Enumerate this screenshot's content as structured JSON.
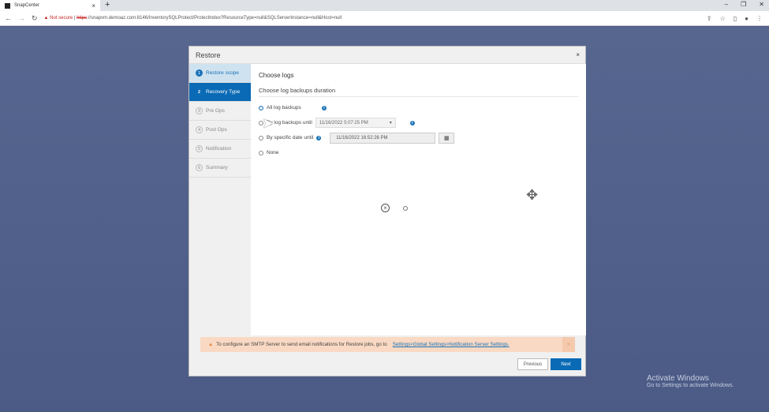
{
  "browser": {
    "tab_title": "SnapCenter",
    "not_secure": "Not secure",
    "url_scheme": "https",
    "url_rest": "://snapvm.demoaz.com:8146/InventorySQLProtect/ProtectIndex?ResourceType=null&SQLServerInstance=null&Host=null"
  },
  "dialog": {
    "title": "Restore",
    "close": "×",
    "steps": [
      {
        "num": "1",
        "label": "Restore scope"
      },
      {
        "num": "2",
        "label": "Recovery Type"
      },
      {
        "num": "3",
        "label": "Pre Ops"
      },
      {
        "num": "4",
        "label": "Post Ops"
      },
      {
        "num": "5",
        "label": "Notification"
      },
      {
        "num": "6",
        "label": "Summary"
      }
    ],
    "heading": "Choose logs",
    "subheading": "Choose log backups duration",
    "options": {
      "all": "All log backups",
      "by_log": "By log backups until",
      "by_date": "By specific date until",
      "none": "None"
    },
    "selected_option": "All log backups",
    "log_backup_select": "11/16/2022 5:07:25 PM",
    "specific_date": "11/16/2022 16:52:26 PM",
    "warning_text": "To configure an SMTP Server to send email notifications for Restore jobs, go to",
    "warning_link": "Settings>Global Settings>Notification Server Settings.",
    "previous": "Previous",
    "next": "Next"
  },
  "watermark": {
    "line1": "Activate Windows",
    "line2": "Go to Settings to activate Windows."
  }
}
